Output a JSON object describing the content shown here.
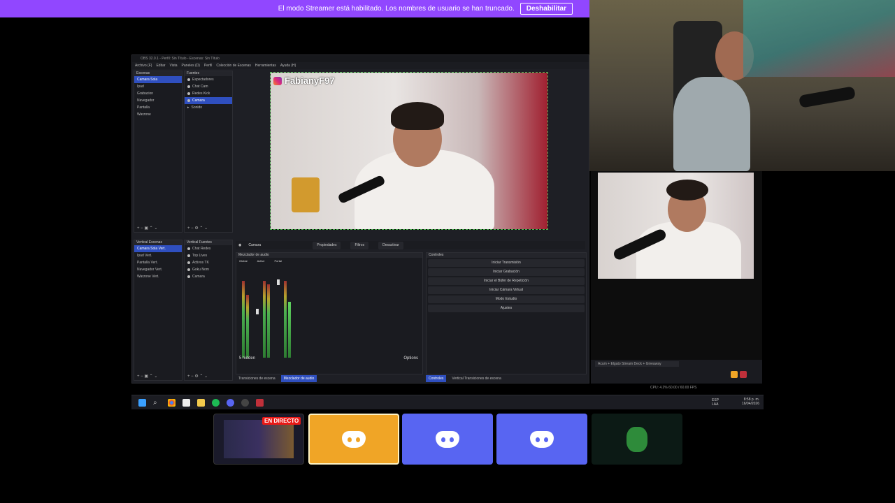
{
  "streamer_bar": {
    "message": "El modo Streamer está habilitado. Los nombres de usuario se han truncado.",
    "button": "Deshabilitar"
  },
  "obs": {
    "title": "OBS 32.0.1 - Perfil: Sin Título - Escenas: Sin Título",
    "menu": [
      "Archivo (F)",
      "Editar",
      "Vista",
      "Paneles (D)",
      "Perfil",
      "Colección de Escenas",
      "Herramientas",
      "Ayuda (H)"
    ],
    "scenes_header": "Escenas",
    "scenes": [
      "Camara Sola",
      "Ipad",
      "Grabacion",
      "Navegador",
      "Pantalla",
      "Warzone"
    ],
    "sources_header": "Fuentes",
    "sources": [
      "Espectadores",
      "Chat Cam",
      "Redes Kick",
      "Camara",
      "Sonido"
    ],
    "vscenes_header": "Vertical Escenas",
    "vscenes": [
      "Camara Sola Vert.",
      "Ipad Vert.",
      "Pantalla Vert.",
      "Navegador Vert.",
      "Warzone Vert."
    ],
    "vsources_header": "Vertical Fuentes",
    "vsources": [
      "Chat Redes",
      "Top Lives",
      "Activos TK",
      "Goku Nom",
      "Camara"
    ],
    "preview_label": "FabianyF97",
    "source_toolbar": {
      "source": "Camara",
      "props": "Propiedades",
      "filters": "Filtros",
      "deactivate": "Desactivar"
    },
    "mixer_header": "Mezclador de audio",
    "mixer_channels": [
      "Global",
      "Active",
      "Portal"
    ],
    "hidden": "5 hidden",
    "options": "Options",
    "controls_header": "Controles",
    "controls": [
      "Iniciar Transmisión",
      "Iniciar Grabación",
      "Iniciar el Búfer de Repetición",
      "Iniciar Cámara Virtual",
      "Modo Estudio",
      "Ajustes"
    ],
    "bottom_tabs_left": [
      "Transiciones de escena",
      "Mezclador de audio"
    ],
    "bottom_tabs_right": [
      "Controles",
      "Vertical Transiciones de escena"
    ]
  },
  "right": {
    "stream_title": "Acum + Elgato Stream Deck + Giveaway",
    "status": "CPU: 4.2%  60.00 / 60.00 FPS"
  },
  "taskbar": {
    "lang": "ESP LAA",
    "time": "8:58 p. m.",
    "date": "16/04/2026"
  },
  "cams": {
    "live_badge": "EN DIRECTO"
  },
  "colors": {
    "accent": "#9147ff",
    "obs_select": "#2f4fbf",
    "discord": "#5865f2",
    "live_speaker": "#f0a526"
  }
}
